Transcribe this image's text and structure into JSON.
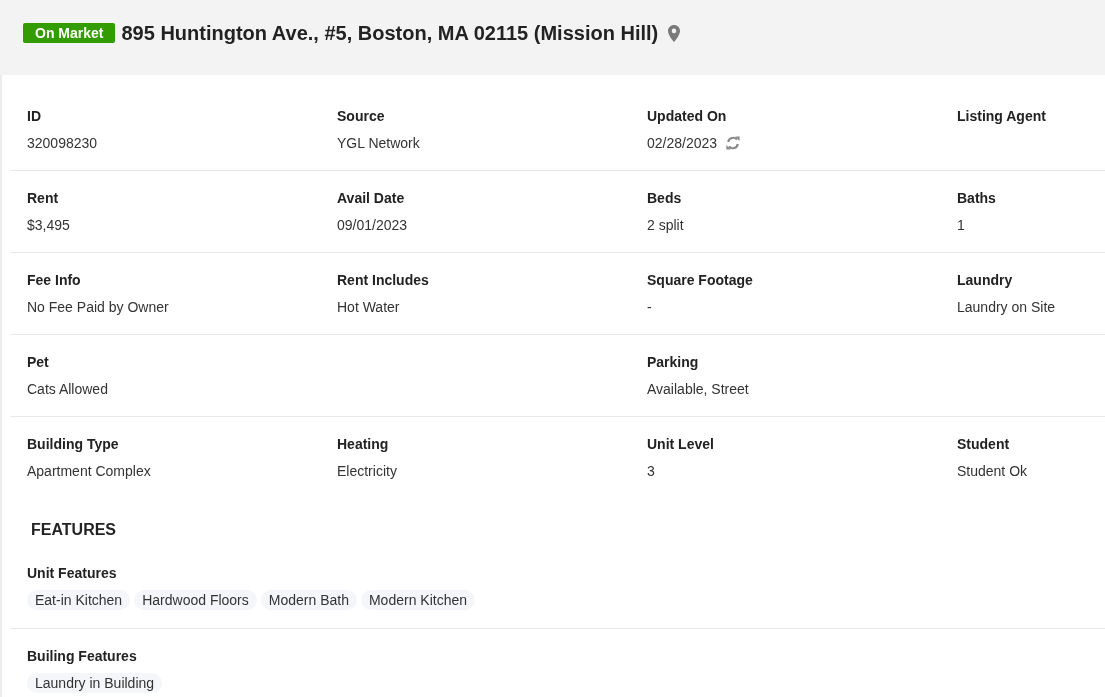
{
  "listing": {
    "status": "On Market",
    "address": "895 Huntington Ave., #5, Boston, MA 02115 (Mission Hill)"
  },
  "details": {
    "rows": [
      {
        "cells": [
          {
            "kind": "field",
            "label": "ID",
            "value": "320098230"
          },
          {
            "kind": "field",
            "label": "Source",
            "value": "YGL Network"
          },
          {
            "kind": "field_refresh",
            "label": "Updated On",
            "value": "02/28/2023"
          },
          {
            "kind": "field",
            "label": "Listing Agent"
          }
        ]
      },
      {
        "cells": [
          {
            "kind": "field",
            "label": "Rent",
            "value": "$3,495"
          },
          {
            "kind": "field",
            "label": "Avail Date",
            "value": "09/01/2023"
          },
          {
            "kind": "field",
            "label": "Beds",
            "value": "2 split"
          },
          {
            "kind": "field",
            "label": "Baths",
            "value": "1"
          }
        ]
      },
      {
        "cells": [
          {
            "kind": "field",
            "label": "Fee Info",
            "value": "No Fee Paid by Owner"
          },
          {
            "kind": "field",
            "label": "Rent Includes",
            "value": "Hot Water"
          },
          {
            "kind": "field",
            "label": "Square Footage",
            "value": "-"
          },
          {
            "kind": "field",
            "label": "Laundry",
            "value": "Laundry on Site"
          }
        ]
      },
      {
        "cells": [
          {
            "kind": "field",
            "label": "Pet",
            "value": "Cats Allowed"
          },
          {
            "kind": "blank"
          },
          {
            "kind": "field",
            "label": "Parking",
            "value": "Available, Street"
          },
          {
            "kind": "blank"
          }
        ]
      },
      {
        "cells": [
          {
            "kind": "field",
            "label": "Building Type",
            "value": "Apartment Complex"
          },
          {
            "kind": "field",
            "label": "Heating",
            "value": "Electricity"
          },
          {
            "kind": "field",
            "label": "Unit Level",
            "value": "3"
          },
          {
            "kind": "field",
            "label": "Student",
            "value": "Student Ok"
          }
        ]
      }
    ]
  },
  "features": {
    "title": "FEATURES",
    "groups": [
      {
        "label": "Unit Features",
        "tags": [
          "Eat-in Kitchen",
          "Hardwood Floors",
          "Modern Bath",
          "Modern Kitchen"
        ]
      },
      {
        "label": "Builing Features",
        "tags": [
          "Laundry in Building"
        ]
      }
    ]
  }
}
